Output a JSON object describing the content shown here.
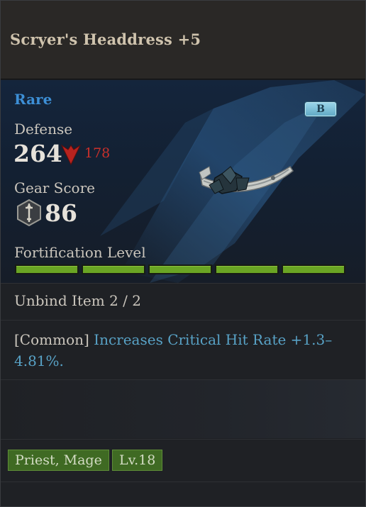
{
  "item": {
    "name": "Scryer's Headdress +5",
    "rarity": "Rare",
    "grade": "B"
  },
  "stats": {
    "defense_label": "Defense",
    "defense_value": "264",
    "defense_diff": "178",
    "defense_trend_icon": "arrow-down-icon",
    "gear_score_label": "Gear Score",
    "gear_score_value": "86",
    "gear_score_icon": "gear-score-icon"
  },
  "fortification": {
    "label": "Fortification Level",
    "segments_filled": 5,
    "segments_total": 5
  },
  "unbind": {
    "text": "Unbind Item 2 / 2"
  },
  "effect": {
    "prefix": "[Common]",
    "description": "Increases Critical Hit Rate +1.3–4.81%."
  },
  "tags": {
    "classes": "Priest, Mage",
    "level": "Lv.18"
  },
  "colors": {
    "rarity": "#3d8fd6",
    "effect_text": "#58a2c6",
    "diff_down": "#c9302b",
    "fort_bar": "#6aa524",
    "tag_bg": "#3f6a23"
  }
}
